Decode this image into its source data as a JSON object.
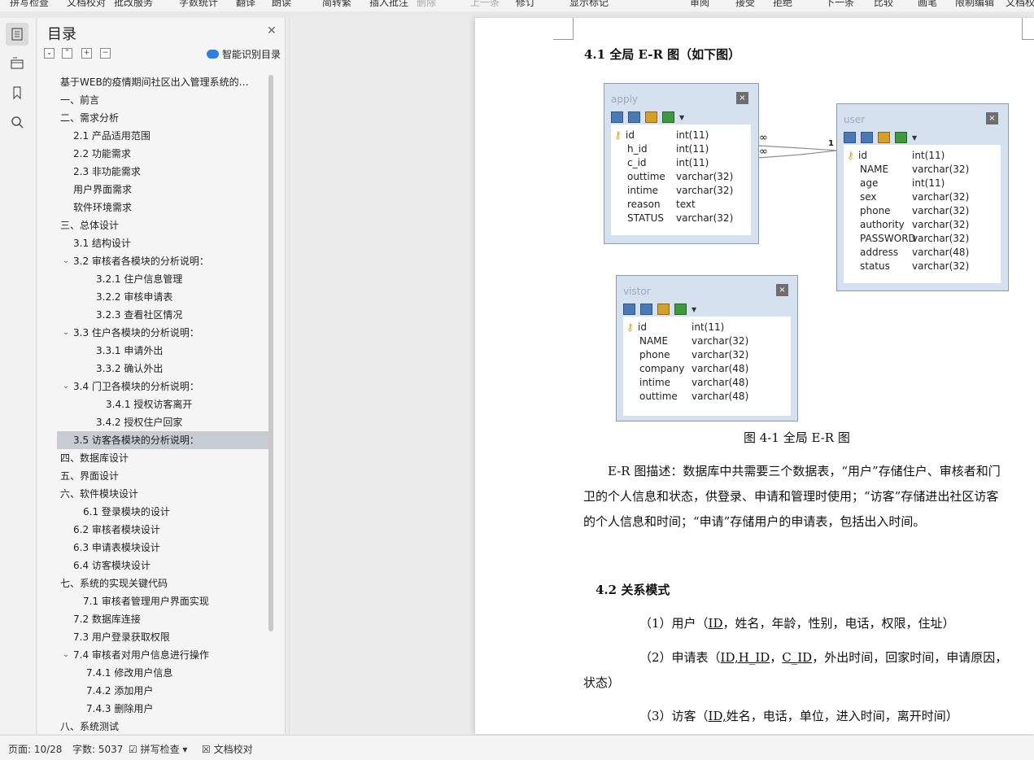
{
  "toolbar": {
    "items": [
      "拼写检查",
      "文档校对",
      "批改服务",
      "字数统计",
      "翻译",
      "朗读",
      "简转繁",
      "插入批注",
      "删除",
      "上一条",
      "下一条",
      "修订",
      "显示标记",
      "审阅",
      "接受",
      "拒绝",
      "下一条",
      "比较",
      "画笔",
      "限制编辑",
      "文档权"
    ]
  },
  "rail": {
    "icons": [
      "toc-icon",
      "nav-icon",
      "bookmark-icon",
      "search-icon"
    ]
  },
  "toc": {
    "title": "目录",
    "smart_label": "智能识别目录",
    "items": [
      {
        "label": "基于WEB的疫情期间社区出入管理系统的…",
        "level": 0,
        "toggle": ""
      },
      {
        "label": "一、前言",
        "level": 0,
        "toggle": ""
      },
      {
        "label": "二、需求分析",
        "level": 0,
        "toggle": "v"
      },
      {
        "label": "2.1 产品适用范围",
        "level": 1,
        "toggle": ""
      },
      {
        "label": "2.2 功能需求",
        "level": 1,
        "toggle": ""
      },
      {
        "label": "2.3 非功能需求",
        "level": 1,
        "toggle": ""
      },
      {
        "label": "用户界面需求",
        "level": 1,
        "toggle": ""
      },
      {
        "label": "软件环境需求",
        "level": 1,
        "toggle": ""
      },
      {
        "label": "三、总体设计",
        "level": 0,
        "toggle": "v"
      },
      {
        "label": "3.1 结构设计",
        "level": 1,
        "toggle": ""
      },
      {
        "label": "3.2 审核者各模块的分析说明：",
        "level": 1,
        "toggle": "v"
      },
      {
        "label": "3.2.1 住户信息管理",
        "level": 2,
        "toggle": ""
      },
      {
        "label": "3.2.2  审核申请表",
        "level": 2,
        "toggle": ""
      },
      {
        "label": "3.2.3  查看社区情况",
        "level": 2,
        "toggle": ""
      },
      {
        "label": "3.3 住户各模块的分析说明：",
        "level": 1,
        "toggle": "v"
      },
      {
        "label": "3.3.1 申请外出",
        "level": 2,
        "toggle": ""
      },
      {
        "label": "3.3.2  确认外出",
        "level": 2,
        "toggle": ""
      },
      {
        "label": "3.4 门卫各模块的分析说明：",
        "level": 1,
        "toggle": "v"
      },
      {
        "label": "3.4.1  授权访客离开",
        "level": 3,
        "toggle": ""
      },
      {
        "label": "3.4.2  授权住户回家",
        "level": 2,
        "toggle": ""
      },
      {
        "label": "3.5 访客各模块的分析说明：",
        "level": 1,
        "toggle": "",
        "selected": true
      },
      {
        "label": "四、数据库设计",
        "level": 0,
        "toggle": ""
      },
      {
        "label": "五、界面设计",
        "level": 0,
        "toggle": ""
      },
      {
        "label": "六、软件模块设计",
        "level": 0,
        "toggle": "v"
      },
      {
        "label": "6.1 登录模块的设计",
        "level": 1.7,
        "toggle": ""
      },
      {
        "label": "6.2 审核者模块设计",
        "level": 1,
        "toggle": ""
      },
      {
        "label": "6.3 申请表模块设计",
        "level": 1,
        "toggle": ""
      },
      {
        "label": "6.4 访客模块设计",
        "level": 1,
        "toggle": ""
      },
      {
        "label": "七、系统的实现关键代码",
        "level": 0,
        "toggle": "v"
      },
      {
        "label": "7.1 审核者管理用户界面实现",
        "level": 1.7,
        "toggle": ""
      },
      {
        "label": "7.2  数据库连接",
        "level": 1,
        "toggle": ""
      },
      {
        "label": "7.3 用户登录获取权限",
        "level": 1,
        "toggle": ""
      },
      {
        "label": "7.4 审核者对用户信息进行操作",
        "level": 1,
        "toggle": "v"
      },
      {
        "label": "7.4.1  修改用户信息",
        "level": 2.2,
        "toggle": ""
      },
      {
        "label": "7.4.2  添加用户",
        "level": 2.2,
        "toggle": ""
      },
      {
        "label": "7.4.3  删除用户",
        "level": 2.2,
        "toggle": ""
      },
      {
        "label": "八、系统测试",
        "level": 0,
        "toggle": "v"
      }
    ]
  },
  "doc": {
    "heading_41": "4.1 全局 E-R 图（如下图）",
    "figure_caption": "图 4-1  全局 E-R 图",
    "er_desc_lines": [
      "E-R 图描述：数据库中共需要三个数据表，“用户”存储住户、审核者和门",
      "卫的个人信息和状态，供登录、申请和管理时使用；“访客”存储进出社区访客",
      "的个人信息和时间；“申请”存储用户的申请表，包括出入时间。"
    ],
    "heading_42": "4.2 关系模式",
    "rel1_pre": "（1）用户（",
    "rel1_key": "ID",
    "rel1_post": "，姓名，年龄，性别，电话，权限，住址）",
    "rel2_pre": "（2）申请表（",
    "rel2_key1": "ID,H_ID",
    "rel2_mid": "，",
    "rel2_key2": "C_ID",
    "rel2_post": "，外出时间，回家时间，申请原因，",
    "rel2_cont": "状态）",
    "rel3_pre": "（3）访客（",
    "rel3_key": "ID,",
    "rel3_post": "姓名，电话，单位，进入时间，离开时间）",
    "er": {
      "apply": {
        "name": "apply",
        "rows": [
          [
            "id",
            "int(11)"
          ],
          [
            "h_id",
            "int(11)"
          ],
          [
            "c_id",
            "int(11)"
          ],
          [
            "outtime",
            "varchar(32)"
          ],
          [
            "intime",
            "varchar(32)"
          ],
          [
            "reason",
            "text"
          ],
          [
            "STATUS",
            "varchar(32)"
          ]
        ]
      },
      "user": {
        "name": "user",
        "rows": [
          [
            "id",
            "int(11)"
          ],
          [
            "NAME",
            "varchar(32)"
          ],
          [
            "age",
            "int(11)"
          ],
          [
            "sex",
            "varchar(32)"
          ],
          [
            "phone",
            "varchar(32)"
          ],
          [
            "authority",
            "varchar(32)"
          ],
          [
            "PASSWORD",
            "varchar(32)"
          ],
          [
            "address",
            "varchar(48)"
          ],
          [
            "status",
            "varchar(32)"
          ]
        ]
      },
      "vistor": {
        "name": "vistor",
        "rows": [
          [
            "id",
            "int(11)"
          ],
          [
            "NAME",
            "varchar(32)"
          ],
          [
            "phone",
            "varchar(32)"
          ],
          [
            "company",
            "varchar(48)"
          ],
          [
            "intime",
            "varchar(48)"
          ],
          [
            "outtime",
            "varchar(48)"
          ]
        ]
      },
      "rel_many": "∞",
      "rel_one": "1",
      "close_glyph": "×"
    }
  },
  "status": {
    "page": "页面: 10/28",
    "words": "字数: 5037",
    "spell": "拼写检查",
    "proof": "文档校对"
  }
}
